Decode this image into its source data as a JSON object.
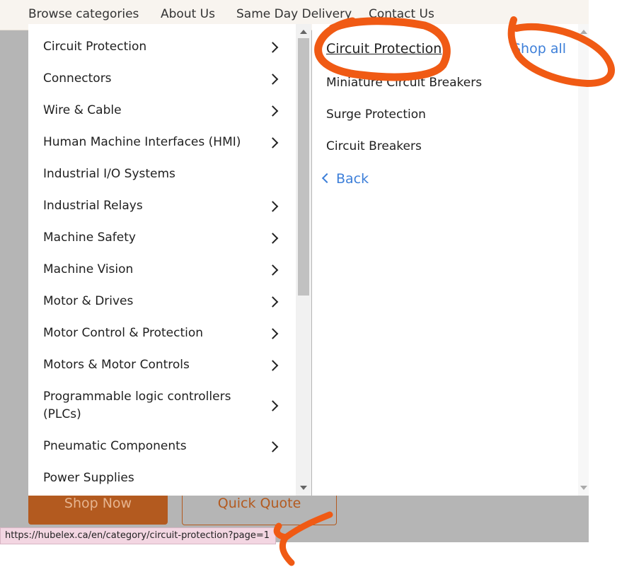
{
  "nav": {
    "items": [
      "Browse categories",
      "About Us",
      "Same Day Delivery",
      "Contact Us"
    ]
  },
  "categories": [
    {
      "label": "Circuit Protection",
      "has_children": true
    },
    {
      "label": "Connectors",
      "has_children": true
    },
    {
      "label": "Wire & Cable",
      "has_children": true
    },
    {
      "label": "Human Machine Interfaces (HMI)",
      "has_children": true
    },
    {
      "label": "Industrial I/O Systems",
      "has_children": false
    },
    {
      "label": "Industrial Relays",
      "has_children": true
    },
    {
      "label": "Machine Safety",
      "has_children": true
    },
    {
      "label": "Machine Vision",
      "has_children": true
    },
    {
      "label": "Motor & Drives",
      "has_children": true
    },
    {
      "label": "Motor Control & Protection",
      "has_children": true
    },
    {
      "label": "Motors & Motor Controls",
      "has_children": true
    },
    {
      "label": "Programmable logic controllers (PLCs)",
      "has_children": true
    },
    {
      "label": "Pneumatic Components",
      "has_children": true
    },
    {
      "label": "Power Supplies",
      "has_children": false
    }
  ],
  "submenu": {
    "title": "Circuit Protection",
    "shop_all": "Shop all",
    "items": [
      "Miniature Circuit Breakers",
      "Surge Protection",
      "Circuit Breakers"
    ],
    "back": "Back"
  },
  "cta": {
    "shop_now": "Shop Now",
    "quick_quote": "Quick Quote"
  },
  "status_url": "https://hubelex.ca/en/category/circuit-protection?page=1",
  "colors": {
    "accent_orange": "#b35a1f",
    "link_blue": "#3d7fd9",
    "annotation_orange": "#f05a14"
  }
}
